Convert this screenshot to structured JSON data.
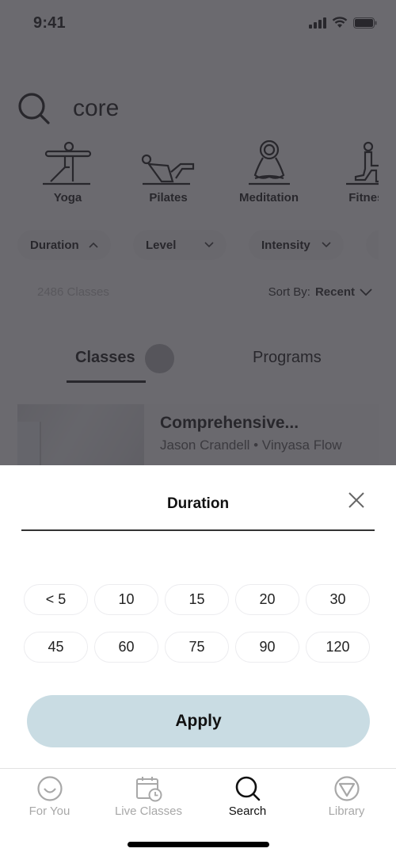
{
  "status_bar": {
    "time": "9:41",
    "icons": [
      "signal-icon",
      "wifi-icon",
      "battery-icon"
    ]
  },
  "search": {
    "query": "core",
    "icon": "search-icon"
  },
  "categories": [
    {
      "label": "Yoga",
      "icon": "yoga-pose-icon"
    },
    {
      "label": "Pilates",
      "icon": "pilates-pose-icon"
    },
    {
      "label": "Meditation",
      "icon": "meditation-pose-icon"
    },
    {
      "label": "Fitness",
      "icon": "fitness-pose-icon"
    }
  ],
  "filters": [
    {
      "label": "Duration",
      "state": "expanded"
    },
    {
      "label": "Level",
      "state": "collapsed"
    },
    {
      "label": "Intensity",
      "state": "collapsed"
    }
  ],
  "results": {
    "count": "2486 Classes",
    "sort_label": "Sort By:",
    "sort_value": "Recent"
  },
  "content_tabs": [
    {
      "label": "Classes",
      "active": true
    },
    {
      "label": "Programs",
      "active": false
    }
  ],
  "class_card": {
    "title": "Comprehensive...",
    "subtitle": "Jason Crandell • Vinyasa Flow"
  },
  "sheet": {
    "title": "Duration",
    "options_row1": [
      "< 5",
      "10",
      "15",
      "20",
      "30"
    ],
    "options_row2": [
      "45",
      "60",
      "75",
      "90",
      "120"
    ],
    "apply_label": "Apply",
    "apply_color": "#c9dce3"
  },
  "tabbar": {
    "items": [
      {
        "label": "For You",
        "icon": "smiley-icon",
        "active": false
      },
      {
        "label": "Live Classes",
        "icon": "calendar-clock-icon",
        "active": false
      },
      {
        "label": "Search",
        "icon": "search-icon",
        "active": true
      },
      {
        "label": "Library",
        "icon": "library-triangle-icon",
        "active": false
      }
    ]
  }
}
